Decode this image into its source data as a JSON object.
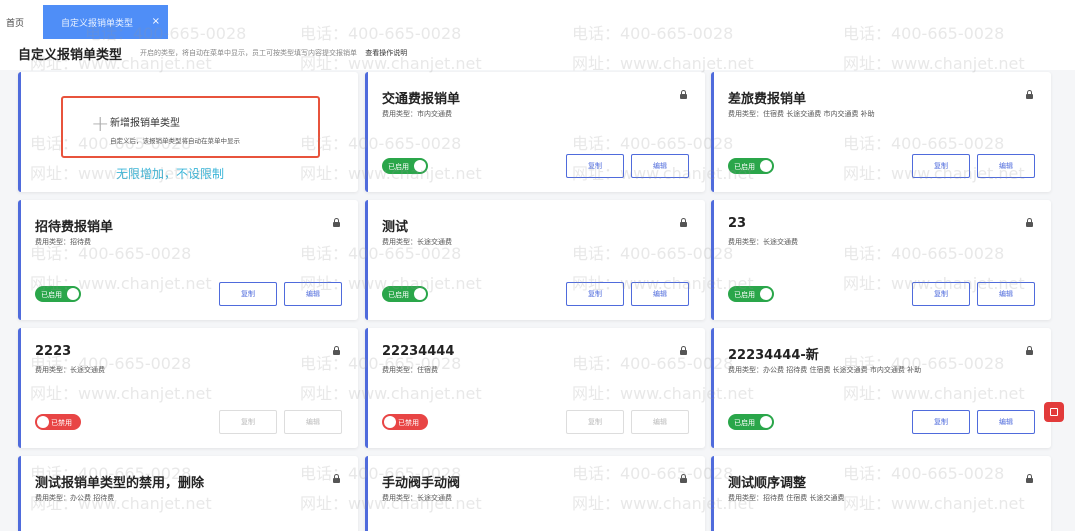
{
  "tabs": {
    "home": "首页",
    "active": "自定义报销单类型",
    "close": "×"
  },
  "page": {
    "title": "自定义报销单类型",
    "description": "开启的类型，将自动在菜单中显示，员工可按类型填写内容提交报销单",
    "guide_link": "查看操作说明"
  },
  "add_card": {
    "title": "新增报销单类型",
    "description": "自定义后，该报销单类型将自动在菜单中显示",
    "note": "无限增加，不设限制"
  },
  "buttons": {
    "copy": "复制",
    "edit": "编辑"
  },
  "toggle": {
    "on": "已启用",
    "off": "已禁用"
  },
  "cards": [
    {
      "title": "交通费报销单",
      "subtitle": "费用类型：市内交通费",
      "enabled": true
    },
    {
      "title": "差旅费报销单",
      "subtitle": "费用类型：住宿费 长途交通费 市内交通费 补助",
      "enabled": true
    },
    {
      "title": "招待费报销单",
      "subtitle": "费用类型：招待费",
      "enabled": true
    },
    {
      "title": "测试",
      "subtitle": "费用类型：长途交通费",
      "enabled": true
    },
    {
      "title": "23",
      "subtitle": "费用类型：长途交通费",
      "enabled": true
    },
    {
      "title": "2223",
      "subtitle": "费用类型：长途交通费",
      "enabled": false
    },
    {
      "title": "22234444",
      "subtitle": "费用类型：住宿费",
      "enabled": false
    },
    {
      "title": "22234444-新",
      "subtitle": "费用类型：办公费 招待费 住宿费 长途交通费 市内交通费 补助",
      "enabled": true
    },
    {
      "title": "测试报销单类型的禁用，删除",
      "subtitle": "费用类型：办公费 招待费"
    },
    {
      "title": "手动阀手动阀",
      "subtitle": "费用类型：长途交通费"
    },
    {
      "title": "测试顺序调整",
      "subtitle": "费用类型：招待费 住宿费 长途交通费"
    }
  ],
  "watermark": {
    "phone": "电话：400-665-0028",
    "site": "网址：www.chanjet.net"
  },
  "colors": {
    "accent": "#4f6bdc",
    "tab_active": "#4f8ef7",
    "enabled": "#2aa64a",
    "disabled": "#e84545",
    "highlight_border": "#e8533c",
    "note_text": "#3ab5d8"
  }
}
